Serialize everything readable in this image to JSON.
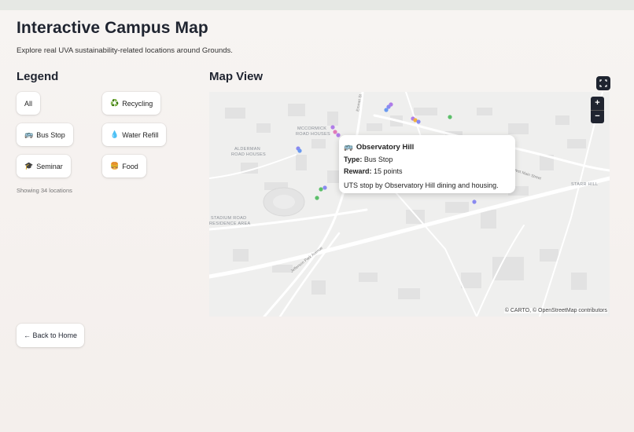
{
  "header": {
    "title": "Interactive Campus Map",
    "subtitle": "Explore real UVA sustainability-related locations around Grounds."
  },
  "legend": {
    "title": "Legend",
    "chips": [
      {
        "label": "All",
        "icon": "",
        "icon_name": ""
      },
      {
        "label": "Recycling",
        "icon": "♻️",
        "icon_name": "recycling-icon"
      },
      {
        "label": "Bus Stop",
        "icon": "🚌",
        "icon_name": "bus-icon"
      },
      {
        "label": "Water Refill",
        "icon": "💧",
        "icon_name": "water-drop-icon"
      },
      {
        "label": "Seminar",
        "icon": "🎓",
        "icon_name": "graduation-cap-icon"
      },
      {
        "label": "Food",
        "icon": "🍔",
        "icon_name": "food-icon"
      }
    ],
    "showing": "Showing 34 locations"
  },
  "map": {
    "title": "Map View",
    "zoom_in": "+",
    "zoom_out": "−",
    "attribution": "© CARTO, © OpenStreetMap contributors",
    "labels": {
      "mccormick": "MCCORMICK",
      "mccormick2": "ROAD HOUSES",
      "alderman": "ALDERMAN",
      "alderman2": "ROAD HOUSES",
      "stadium": "STADIUM ROAD",
      "stadium2": "RESIDENCE AREA",
      "starr": "STARR HILL",
      "jpa": "Jefferson Park Avenue",
      "emmet": "Emmet St",
      "main": "West Main Street"
    },
    "popup": {
      "icon": "🚌",
      "title": "Observatory Hill",
      "type_label": "Type:",
      "type_value": "Bus Stop",
      "reward_label": "Reward:",
      "reward_value": "15 points",
      "description": "UTS stop by Observatory Hill dining and housing."
    },
    "marker_colors": {
      "bus_stop": "#8a8af0",
      "recycling": "#5cbf6a",
      "seminar": "#b07ce8",
      "food": "#f0b040",
      "water": "#6a9af0"
    }
  },
  "footer": {
    "back_label": "← Back to Home"
  }
}
